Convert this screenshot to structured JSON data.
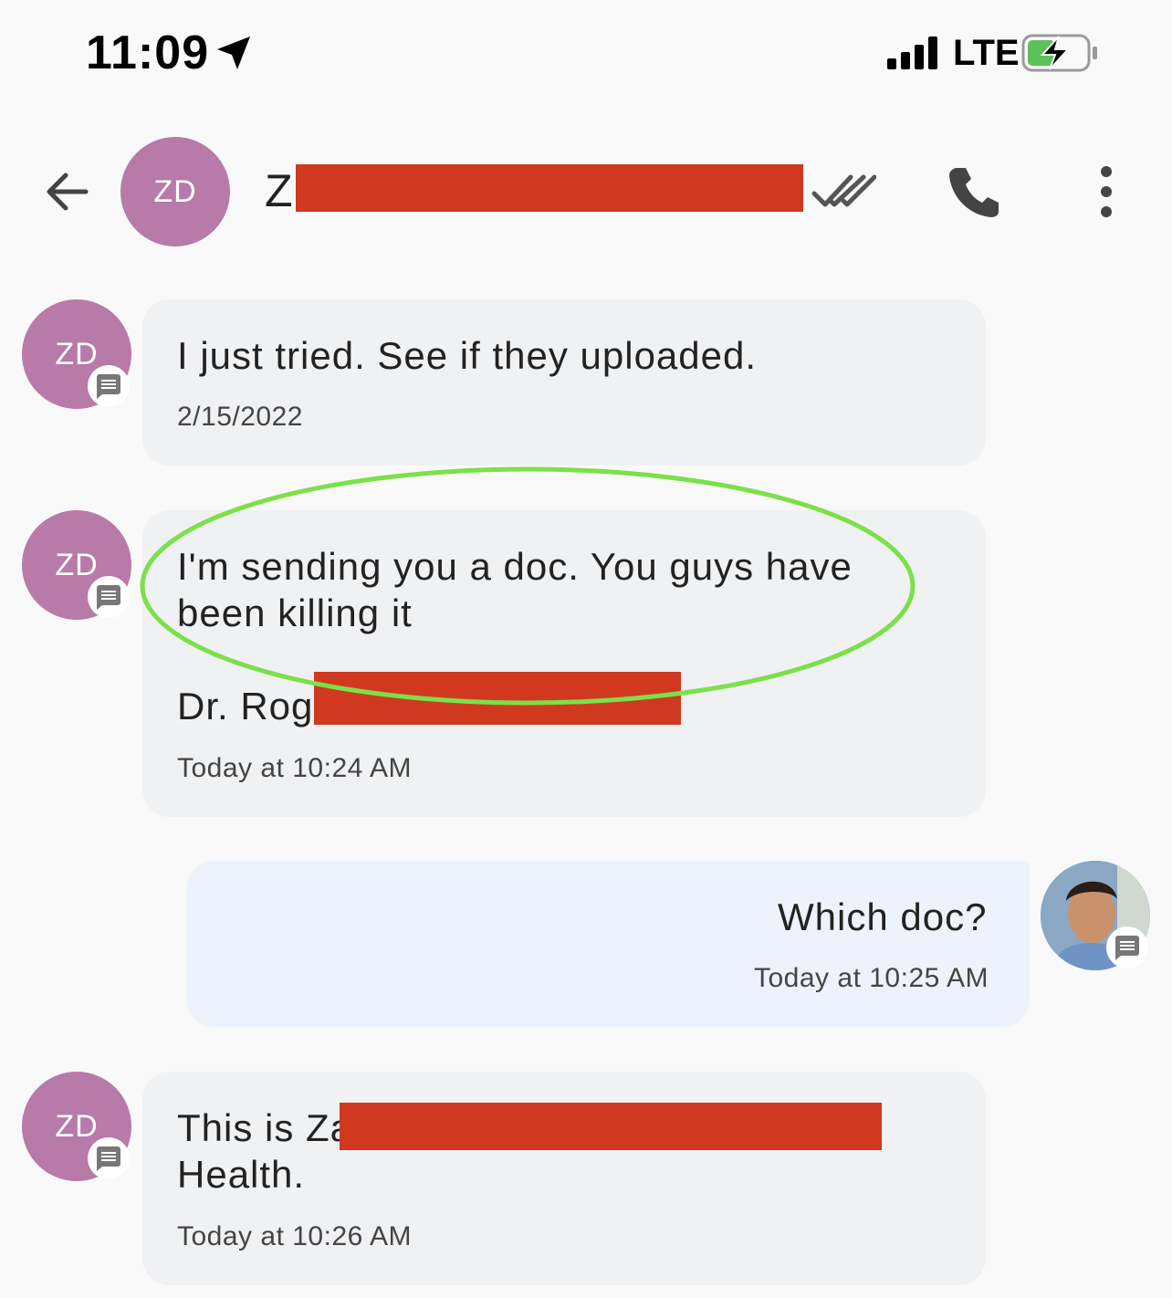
{
  "status_bar": {
    "time": "11:09",
    "network": "LTE",
    "location_icon": "location-arrow-icon",
    "signal_icon": "signal-bars-icon",
    "battery_icon": "battery-charging-icon"
  },
  "header": {
    "back_icon": "arrow-left-icon",
    "avatar_initials": "ZD",
    "contact_name_visible": "Z",
    "read_icon": "double-check-icon",
    "call_icon": "phone-icon",
    "more_icon": "more-vertical-icon"
  },
  "messages": [
    {
      "direction": "incoming",
      "avatar": "ZD",
      "text": "I just tried. See if they uploaded.",
      "time": "2/15/2022"
    },
    {
      "direction": "incoming",
      "avatar": "ZD",
      "text_line1": "I'm sending you a doc. You guys have",
      "text_line2": "been killing it",
      "signature": "Dr. Rog",
      "time": "Today at 10:24 AM"
    },
    {
      "direction": "outgoing",
      "avatar": "photo",
      "text": "Which doc?",
      "time": "Today at 10:25 AM"
    },
    {
      "direction": "incoming",
      "avatar": "ZD",
      "text_line1": "This is Za",
      "text_line2": "Health.",
      "time": "Today at 10:26 AM"
    }
  ],
  "colors": {
    "avatar_bg": "#b87aa8",
    "incoming_bubble": "#f0f1f3",
    "outgoing_bubble": "#edf3fc",
    "redaction": "#d0391f",
    "highlight_ellipse": "#7be04a"
  }
}
